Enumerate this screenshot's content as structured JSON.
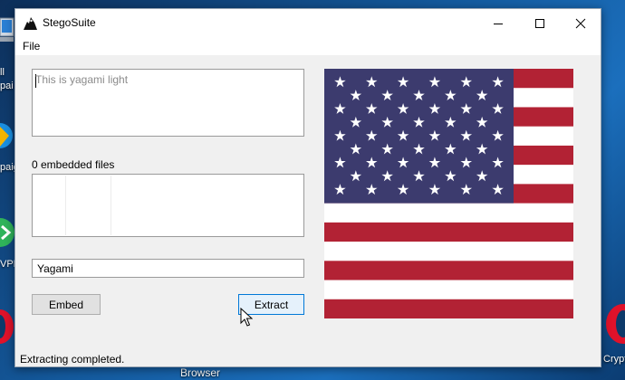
{
  "window": {
    "title": "StegoSuite",
    "controls": [
      "minimize",
      "maximize",
      "close"
    ]
  },
  "menu": {
    "file": "File"
  },
  "message": {
    "placeholder": "This is yagami light"
  },
  "files": {
    "label": "0 embedded files"
  },
  "password": {
    "value": "Yagami"
  },
  "buttons": {
    "embed": "Embed",
    "extract": "Extract"
  },
  "image": {
    "icon": "us-flag-image",
    "colors": {
      "red": "#b22234",
      "white": "#ffffff",
      "blue": "#3c3b6e"
    }
  },
  "status": {
    "text": "Extracting completed."
  },
  "desktop": {
    "left_labels": [
      "ll",
      "pai",
      "paig",
      "VPN"
    ],
    "right_labels": [
      "Crypt"
    ],
    "bottom_label": "Browser"
  },
  "colors": {
    "accent": "#0078d7",
    "window_bg": "#f0f0f0"
  }
}
